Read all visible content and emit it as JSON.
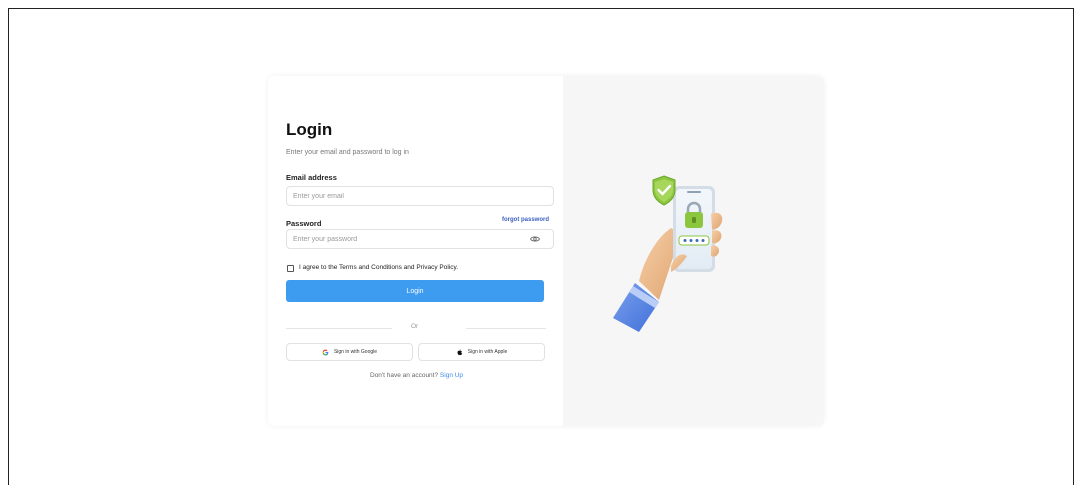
{
  "login": {
    "title": "Login",
    "subtitle": "Enter your email and password to log in",
    "email_label": "Email address",
    "email_placeholder": "Enter your email",
    "email_value": "",
    "password_label": "Password",
    "forgot_label": "forgot password",
    "password_placeholder": "Enter your password",
    "password_value": "",
    "agree_label": "I agree to the Terms and Conditions and Privacy Policy.",
    "agree_checked": false,
    "submit_label": "Login",
    "divider_label": "Or",
    "google_label": "Sign in with Google",
    "apple_label": "Sign in with Apple",
    "no_account_label": "Don't have an account?",
    "signup_label": "Sign Up"
  },
  "icons": {
    "eye": "eye-icon",
    "google": "google-logo-icon",
    "apple": "apple-logo-icon",
    "illustration": "phone-security-illustration"
  },
  "colors": {
    "accent": "#3d9bf0",
    "link": "#3a5fbf",
    "signup_link": "#3d8ce8",
    "illustration_bg": "#f6f6f7",
    "shield_green": "#8cc63f"
  }
}
